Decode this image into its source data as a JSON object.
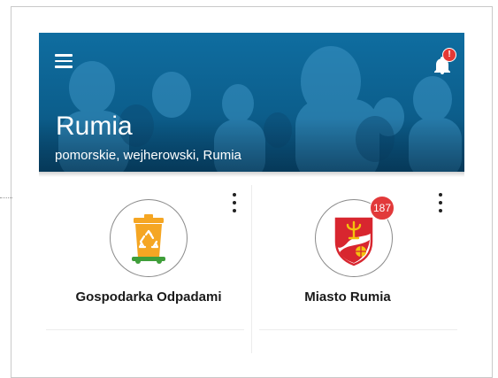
{
  "header": {
    "city_name": "Rumia",
    "location": "pomorskie, wejherowski, Rumia",
    "notification_badge": "!"
  },
  "tiles": [
    {
      "label": "Gospodarka Odpadami",
      "icon": "recycling-bin-icon",
      "badge": ""
    },
    {
      "label": "Miasto Rumia",
      "icon": "rumia-coat-of-arms-icon",
      "badge": "187"
    }
  ],
  "colors": {
    "header_blue": "#0c5f8d",
    "badge_red": "#e53935",
    "bin_orange": "#f5a623",
    "bin_green": "#3f9e3a",
    "crest_red": "#d8262f"
  }
}
